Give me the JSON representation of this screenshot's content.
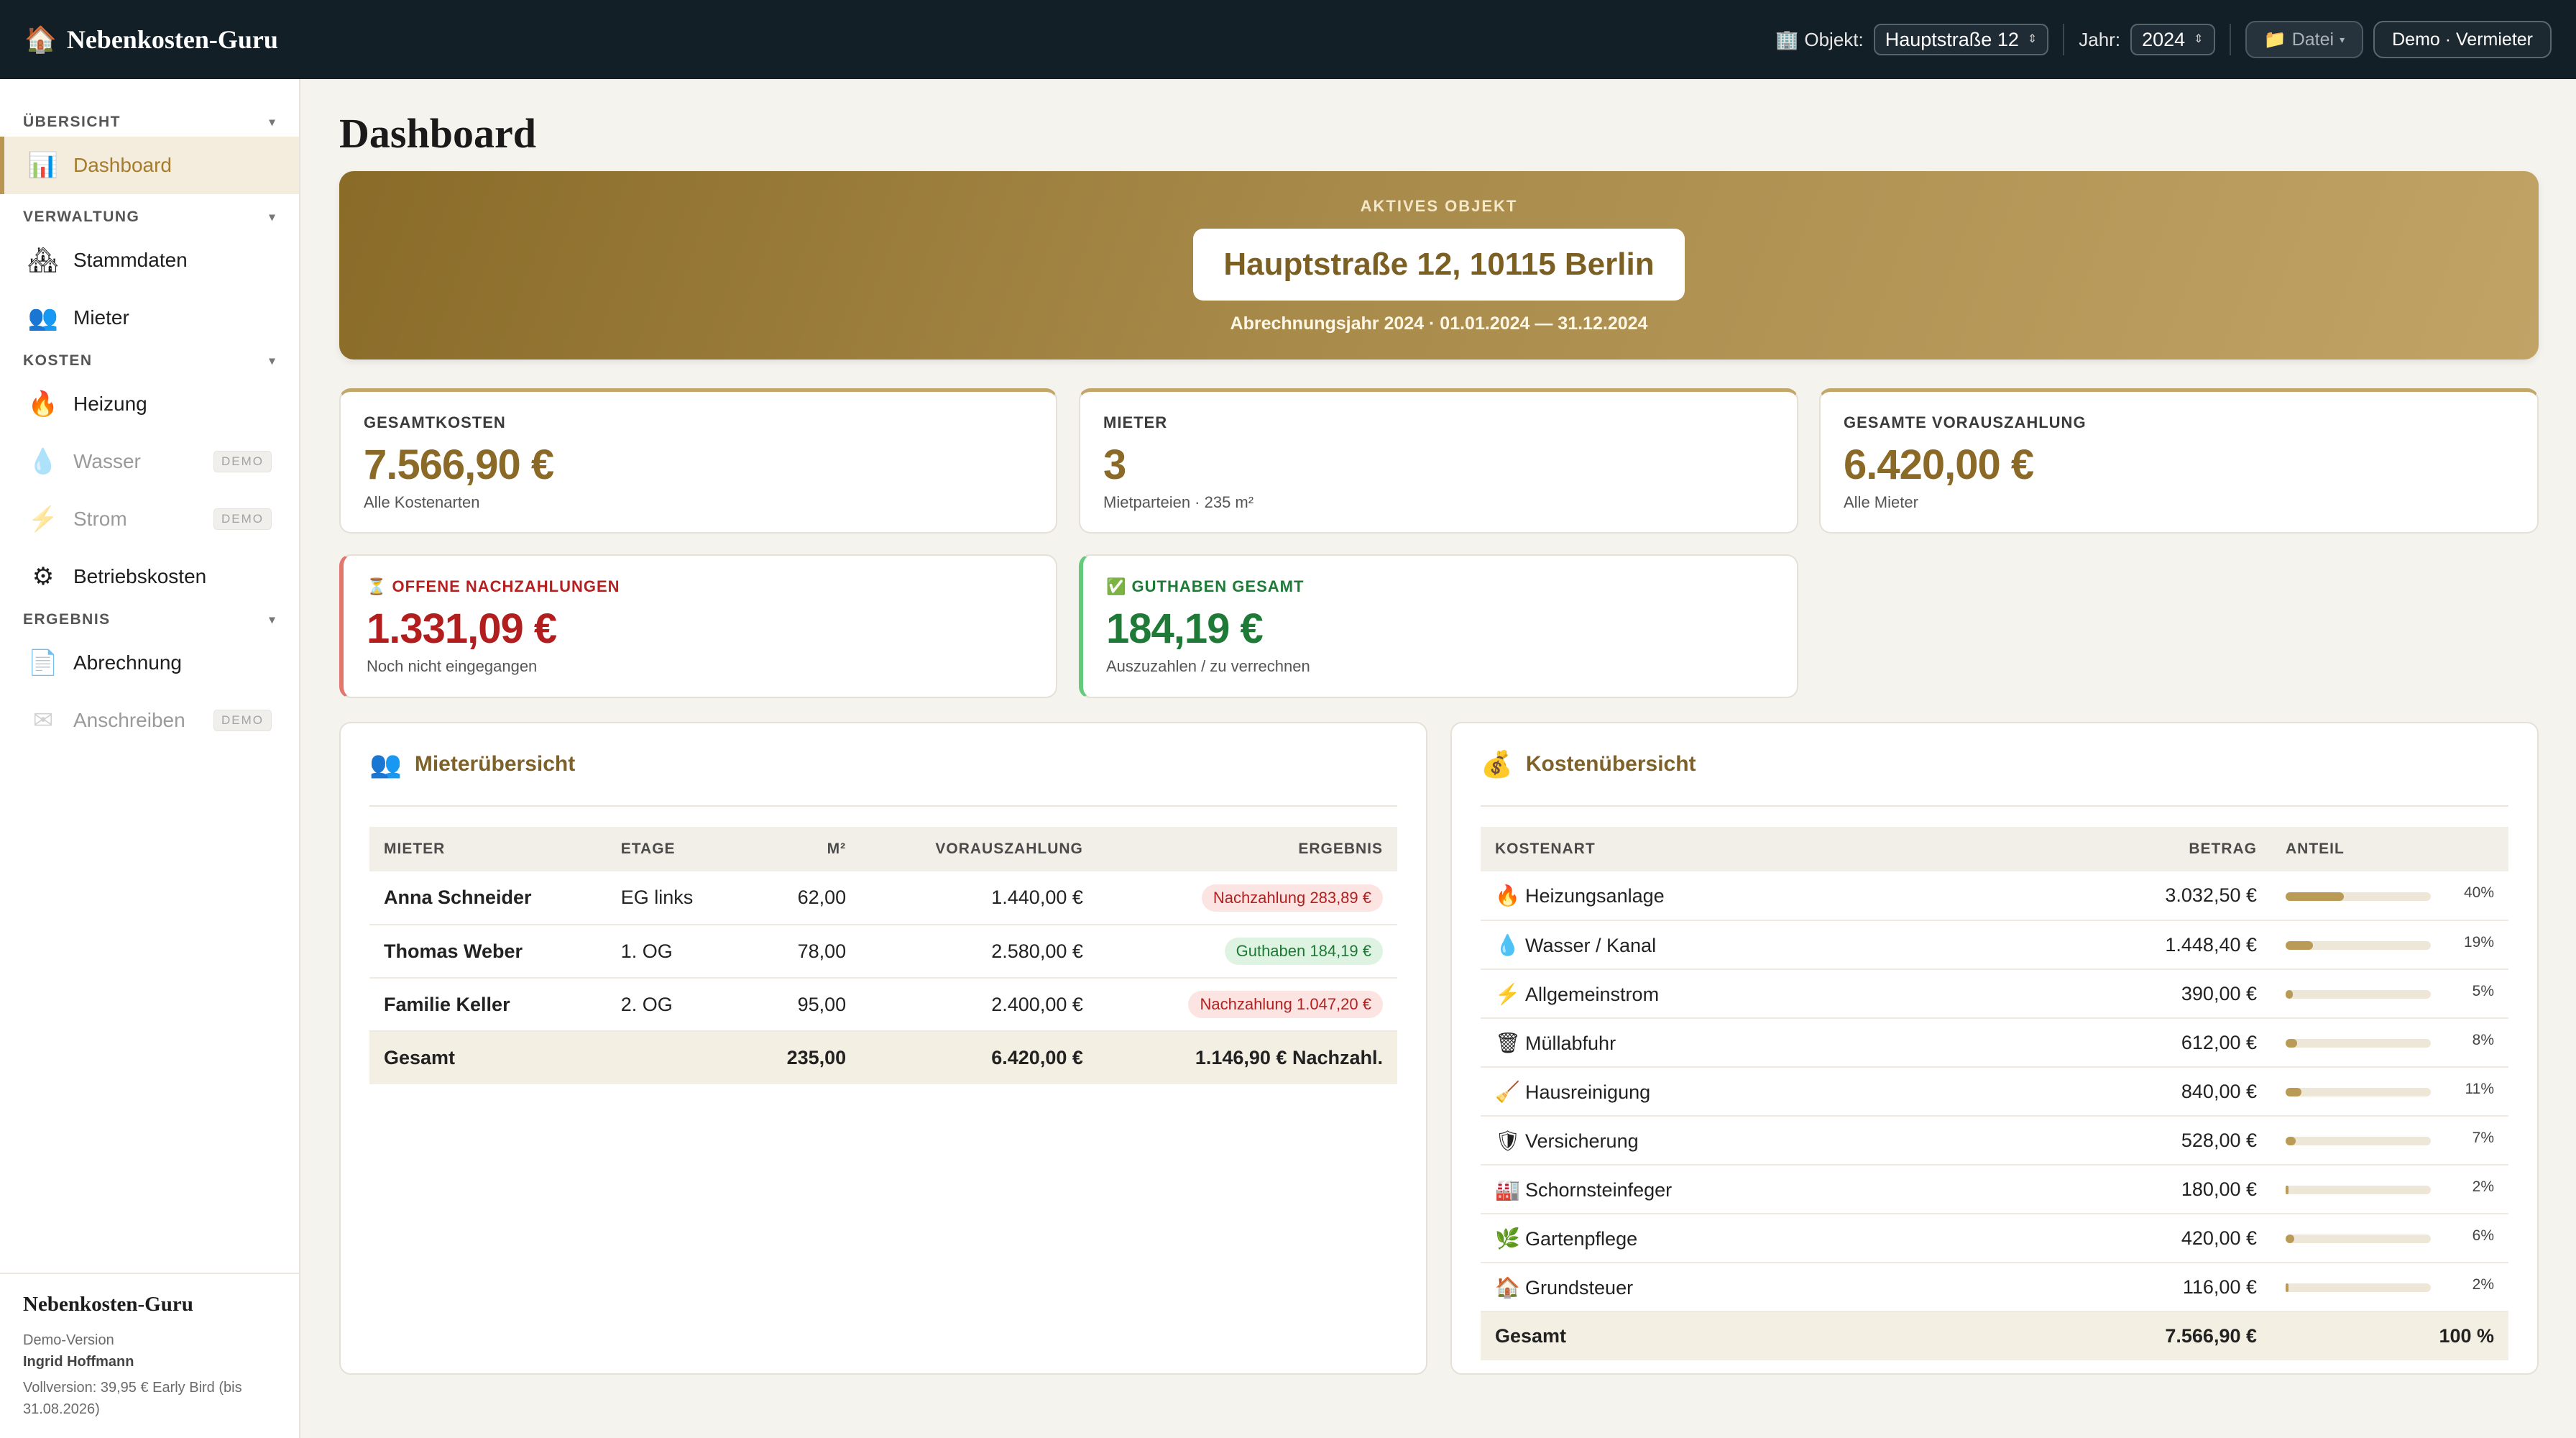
{
  "app": {
    "name": "Nebenkosten-Guru",
    "logo_icon": "house-icon"
  },
  "topbar": {
    "objekt_label": "Objekt:",
    "objekt_value": "Hauptstraße 12",
    "jahr_label": "Jahr:",
    "jahr_value": "2024",
    "datei_label": "Datei",
    "user_label": "Demo · Vermieter"
  },
  "sidebar": {
    "sections": [
      {
        "title": "ÜBERSICHT",
        "items": [
          {
            "label": "Dashboard",
            "icon": "bar-chart-icon",
            "active": true
          }
        ]
      },
      {
        "title": "VERWALTUNG",
        "items": [
          {
            "label": "Stammdaten",
            "icon": "building-icon"
          },
          {
            "label": "Mieter",
            "icon": "users-icon"
          }
        ]
      },
      {
        "title": "KOSTEN",
        "items": [
          {
            "label": "Heizung",
            "icon": "fire-icon"
          },
          {
            "label": "Wasser",
            "icon": "droplet-icon",
            "demo": "DEMO"
          },
          {
            "label": "Strom",
            "icon": "lightning-icon",
            "demo": "DEMO"
          },
          {
            "label": "Betriebskosten",
            "icon": "gear-icon"
          }
        ]
      },
      {
        "title": "ERGEBNIS",
        "items": [
          {
            "label": "Abrechnung",
            "icon": "document-icon"
          },
          {
            "label": "Anschreiben",
            "icon": "envelope-icon",
            "demo": "DEMO"
          }
        ]
      }
    ],
    "footer": {
      "title": "Nebenkosten-Guru",
      "version": "Demo-Version",
      "user": "Ingrid Hoffmann",
      "offer": "Vollversion: 39,95 € Early Bird (bis 31.08.2026)"
    }
  },
  "main": {
    "title": "Dashboard",
    "hero": {
      "label": "AKTIVES OBJEKT",
      "address": "Hauptstraße 12, 10115 Berlin",
      "subtitle": "Abrechnungsjahr 2024 · 01.01.2024 — 31.12.2024"
    },
    "kpis": [
      {
        "label": "GESAMTKOSTEN",
        "value": "7.566,90 €",
        "sub": "Alle Kostenarten"
      },
      {
        "label": "MIETER",
        "value": "3",
        "sub": "Mietparteien · 235 m²"
      },
      {
        "label": "GESAMTE VORAUSZAHLUNG",
        "value": "6.420,00 €",
        "sub": "Alle Mieter"
      },
      {
        "label": "OFFENE NACHZAHLUNGEN",
        "icon": "hourglass-icon",
        "value": "1.331,09 €",
        "sub": "Noch nicht eingegangen"
      },
      {
        "label": "GUTHABEN GESAMT",
        "icon": "check-icon",
        "value": "184,19 €",
        "sub": "Auszuzahlen / zu verrechnen"
      }
    ],
    "mieter_panel": {
      "title": "Mieterübersicht",
      "columns": [
        "MIETER",
        "ETAGE",
        "M²",
        "VORAUSZAHLUNG",
        "ERGEBNIS"
      ],
      "rows": [
        {
          "name": "Anna Schneider",
          "etage": "EG links",
          "qm": "62,00",
          "vz": "1.440,00 €",
          "ergebnis": "Nachzahlung 283,89 €",
          "status": "red"
        },
        {
          "name": "Thomas Weber",
          "etage": "1. OG",
          "qm": "78,00",
          "vz": "2.580,00 €",
          "ergebnis": "Guthaben 184,19 €",
          "status": "green"
        },
        {
          "name": "Familie Keller",
          "etage": "2. OG",
          "qm": "95,00",
          "vz": "2.400,00 €",
          "ergebnis": "Nachzahlung 1.047,20 €",
          "status": "red"
        }
      ],
      "total": {
        "label": "Gesamt",
        "qm": "235,00",
        "vz": "6.420,00 €",
        "ergebnis": "1.146,90 € Nachzahl."
      }
    },
    "kosten_panel": {
      "title": "Kostenübersicht",
      "columns": [
        "KOSTENART",
        "BETRAG",
        "ANTEIL"
      ],
      "rows": [
        {
          "icon": "fire-icon",
          "glyph": "🔥",
          "name": "Heizungsanlage",
          "betrag": "3.032,50 €",
          "anteil": "40%",
          "share": 0.4
        },
        {
          "icon": "droplet-icon",
          "glyph": "💧",
          "name": "Wasser / Kanal",
          "betrag": "1.448,40 €",
          "anteil": "19%",
          "share": 0.19
        },
        {
          "icon": "lightning-icon",
          "glyph": "⚡",
          "name": "Allgemeinstrom",
          "betrag": "390,00 €",
          "anteil": "5%",
          "share": 0.05
        },
        {
          "icon": "trash-icon",
          "glyph": "🗑",
          "name": "Müllabfuhr",
          "betrag": "612,00 €",
          "anteil": "8%",
          "share": 0.08
        },
        {
          "icon": "broom-icon",
          "glyph": "🧹",
          "name": "Hausreinigung",
          "betrag": "840,00 €",
          "anteil": "11%",
          "share": 0.11
        },
        {
          "icon": "shield-icon",
          "glyph": "🛡",
          "name": "Versicherung",
          "betrag": "528,00 €",
          "anteil": "7%",
          "share": 0.07
        },
        {
          "icon": "factory-icon",
          "glyph": "🏭",
          "name": "Schornsteinfeger",
          "betrag": "180,00 €",
          "anteil": "2%",
          "share": 0.02
        },
        {
          "icon": "leaf-icon",
          "glyph": "🌿",
          "name": "Gartenpflege",
          "betrag": "420,00 €",
          "anteil": "6%",
          "share": 0.06
        },
        {
          "icon": "house-icon",
          "glyph": "🏠",
          "name": "Grundsteuer",
          "betrag": "116,00 €",
          "anteil": "2%",
          "share": 0.02
        }
      ],
      "total": {
        "label": "Gesamt",
        "betrag": "7.566,90 €",
        "anteil": "100 %"
      }
    }
  },
  "colors": {
    "accent": "#b89550",
    "topbar": "#131f27",
    "red": "#b21e1e",
    "green": "#1f7a38"
  }
}
